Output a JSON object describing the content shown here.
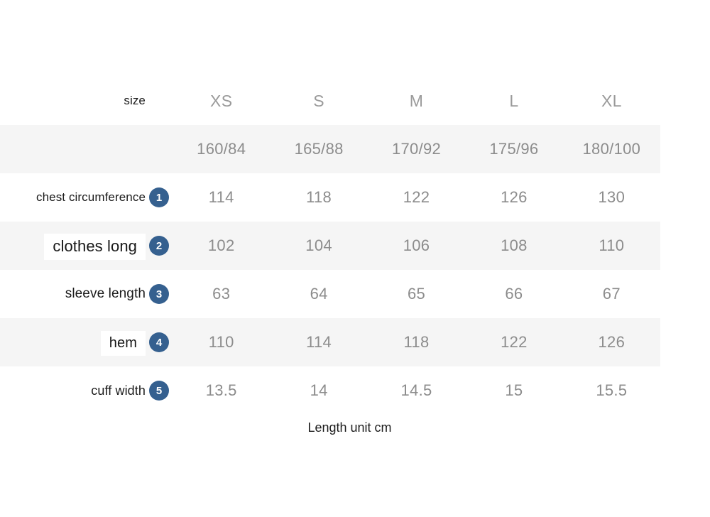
{
  "chart_data": {
    "type": "table",
    "title": "size",
    "unit_note": "Length unit cm",
    "columns": [
      "XS",
      "S",
      "M",
      "L",
      "XL"
    ],
    "height_bust": [
      "160/84",
      "165/88",
      "170/92",
      "175/96",
      "180/100"
    ],
    "rows": [
      {
        "badge": "1",
        "label": "chest circumference",
        "values": [
          "114",
          "118",
          "122",
          "126",
          "130"
        ]
      },
      {
        "badge": "2",
        "label": "clothes long",
        "values": [
          "102",
          "104",
          "106",
          "108",
          "110"
        ]
      },
      {
        "badge": "3",
        "label": "sleeve length",
        "values": [
          "63",
          "64",
          "65",
          "66",
          "67"
        ]
      },
      {
        "badge": "4",
        "label": "hem",
        "values": [
          "110",
          "114",
          "118",
          "122",
          "126"
        ]
      },
      {
        "badge": "5",
        "label": "cuff width",
        "values": [
          "13.5",
          "14",
          "14.5",
          "15",
          "15.5"
        ]
      }
    ]
  },
  "header": {
    "size_label": "size",
    "col_xs": "XS",
    "col_s": "S",
    "col_m": "M",
    "col_l": "L",
    "col_xl": "XL"
  },
  "subheader": {
    "ghost_label": "",
    "xs": "160/84",
    "s": "165/88",
    "m": "170/92",
    "l": "175/96",
    "xl": "180/100"
  },
  "rows": [
    {
      "badge": "1",
      "label": "chest circumference",
      "xs": "114",
      "s": "118",
      "m": "122",
      "l": "126",
      "xl": "130"
    },
    {
      "badge": "2",
      "label": "clothes long",
      "xs": "102",
      "s": "104",
      "m": "106",
      "l": "108",
      "xl": "110"
    },
    {
      "badge": "3",
      "label": "sleeve length",
      "xs": "63",
      "s": "64",
      "m": "65",
      "l": "66",
      "xl": "67"
    },
    {
      "badge": "4",
      "label": "hem",
      "xs": "110",
      "s": "114",
      "m": "118",
      "l": "122",
      "xl": "126"
    },
    {
      "badge": "5",
      "label": "cuff width",
      "xs": "13.5",
      "s": "14",
      "m": "14.5",
      "l": "15",
      "xl": "15.5"
    }
  ],
  "footer": {
    "note": "Length unit cm"
  },
  "colors": {
    "badge_blue": "#35608f",
    "stripe_gray": "#f5f5f5",
    "value_gray": "#8c8c8c",
    "label_black": "#1b1b1b",
    "background": "#ffffff"
  }
}
